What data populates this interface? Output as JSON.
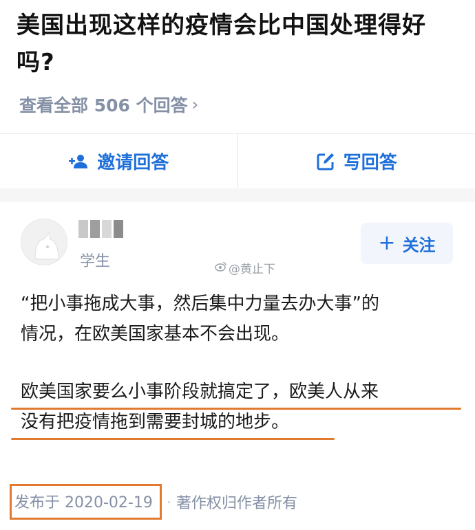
{
  "question": {
    "title": "美国出现这样的疫情会比中国处理得好吗?",
    "view_all": "查看全部 506 个回答",
    "chevron": "›"
  },
  "actions": {
    "invite_label": "邀请回答",
    "invite_icon": "add-person-icon",
    "write_label": "写回答",
    "write_icon": "edit-icon"
  },
  "author": {
    "title": "学生",
    "follow_label": "关注",
    "follow_icon": "plus-icon"
  },
  "watermark": "@黄止下",
  "answer": {
    "para1_line1": "“把小事拖成大事，然后集中力量去办大事”的",
    "para1_line2": "情况，在欧美国家基本不会出现。",
    "para2_line1": "欧美国家要么小事阶段就搞定了，欧美人从来",
    "para2_line2": "没有把疫情拖到需要封城的地步。"
  },
  "meta": {
    "published": "发布于 2020-02-19",
    "separator": "·",
    "copyright": "著作权归作者所有"
  },
  "colors": {
    "accent": "#1e6fd9",
    "highlight": "#e07a2e",
    "muted": "#8590a6"
  }
}
